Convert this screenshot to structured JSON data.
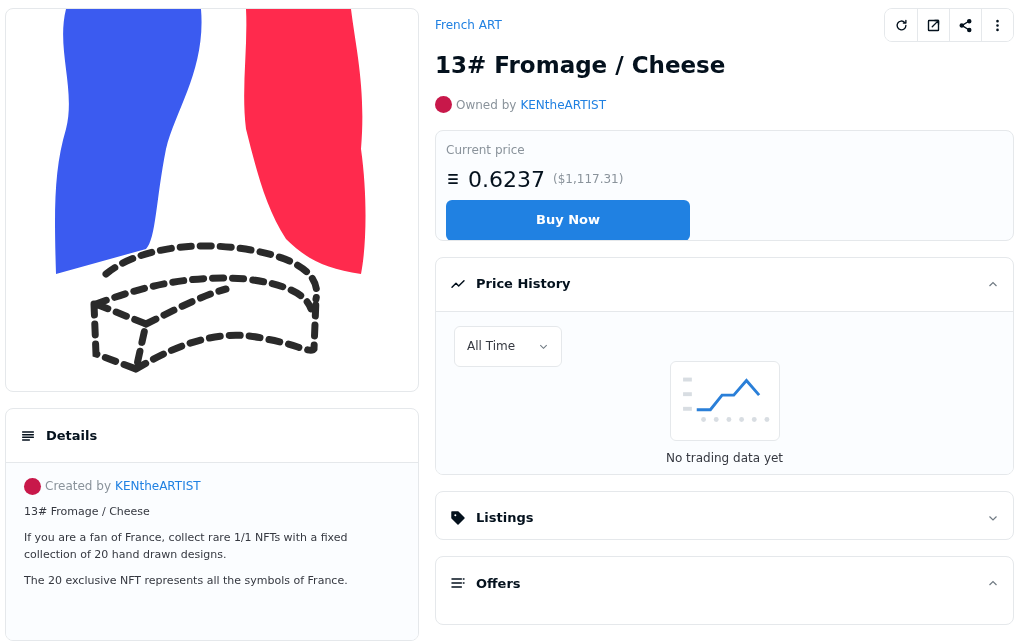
{
  "collection": "French ART",
  "toolbar": {
    "buttons": [
      {
        "kind": "refresh"
      },
      {
        "kind": "external"
      },
      {
        "kind": "share"
      },
      {
        "kind": "more"
      }
    ]
  },
  "title": "13# Fromage / Cheese",
  "owner": {
    "prefix": "Owned by",
    "name": "KENtheARTIST"
  },
  "price": {
    "label": "Current price",
    "amount": "0.6237",
    "usd": "($1,117.31)",
    "button": "Buy Now"
  },
  "details": {
    "title": "Details",
    "creator_prefix": "Created by",
    "creator": "KENtheARTIST",
    "paragraphs": [
      "13# Fromage / Cheese",
      "If you are a fan of France, collect rare 1/1 NFTs with a fixed collection of 20 hand drawn designs.",
      "The 20 exclusive NFT represents all the symbols of France."
    ]
  },
  "panels": [
    {
      "kind": "history",
      "title": "Price History",
      "expanded": true,
      "filter": "All Time",
      "empty_text": "No trading data yet"
    },
    {
      "kind": "listings",
      "title": "Listings",
      "expanded": false
    },
    {
      "kind": "offers",
      "title": "Offers",
      "expanded": true
    }
  ]
}
